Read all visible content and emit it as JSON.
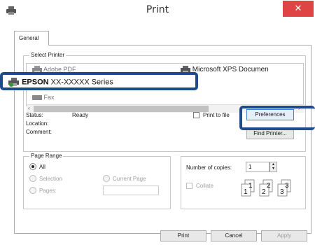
{
  "window": {
    "title": "Print",
    "close_label": "✕"
  },
  "tabs": [
    {
      "label": "General"
    }
  ],
  "select_printer": {
    "group_label": "Select Printer",
    "printers": [
      {
        "label": "Adobe PDF"
      },
      {
        "label": "Microsoft XPS Documen"
      },
      {
        "label": "Fax"
      }
    ],
    "selected": {
      "brand": "EPSON",
      "model": " XX-XXXXX Series"
    },
    "status_label": "Status:",
    "status_value": "Ready",
    "location_label": "Location:",
    "comment_label": "Comment:",
    "print_to_file_label": "Print to file",
    "preferences_label": "Preferences",
    "find_printer_label": "Find Printer..."
  },
  "page_range": {
    "group_label": "Page Range",
    "options": [
      {
        "label": "All",
        "selected": true,
        "enabled": true
      },
      {
        "label": "Selection",
        "selected": false,
        "enabled": false
      },
      {
        "label": "Current Page",
        "selected": false,
        "enabled": false
      },
      {
        "label": "Pages:",
        "selected": false,
        "enabled": false
      }
    ],
    "pages_value": ""
  },
  "copies": {
    "number_label": "Number of copies:",
    "number_value": "1",
    "collate_label": "Collate",
    "collate_checked": false,
    "collate_pages": [
      "1",
      "1",
      "2",
      "2",
      "3",
      "3"
    ]
  },
  "footer": {
    "print_label": "Print",
    "cancel_label": "Cancel",
    "apply_label": "Apply"
  },
  "colors": {
    "close": "#e04343",
    "highlight": "#1f4a8c",
    "focus": "#3b7ddb"
  }
}
